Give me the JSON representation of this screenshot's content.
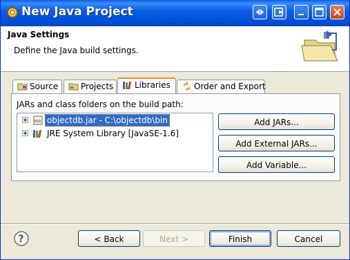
{
  "window": {
    "title": "New Java Project"
  },
  "header": {
    "title": "Java Settings",
    "description": "Define the Java build settings."
  },
  "tabs": [
    {
      "label": "Source",
      "icon": "source-folder-icon"
    },
    {
      "label": "Projects",
      "icon": "projects-icon"
    },
    {
      "label": "Libraries",
      "icon": "libraries-icon",
      "selected": true
    },
    {
      "label": "Order and Export",
      "icon": "order-export-icon"
    }
  ],
  "libraries": {
    "build_path_label": "JARs and class folders on the build path:",
    "entries": [
      {
        "label": "objectdb.jar - C:\\objectdb\\bin",
        "icon": "jar-icon",
        "selected": true
      },
      {
        "label": "JRE System Library [JavaSE-1.6]",
        "icon": "library-icon",
        "selected": false
      }
    ],
    "buttons": {
      "add_jars": "Add JARs...",
      "add_external_jars": "Add External JARs...",
      "add_variable": "Add Variable..."
    }
  },
  "footer": {
    "back": "< Back",
    "next": "Next >",
    "finish": "Finish",
    "cancel": "Cancel",
    "help_icon": "help-icon"
  }
}
